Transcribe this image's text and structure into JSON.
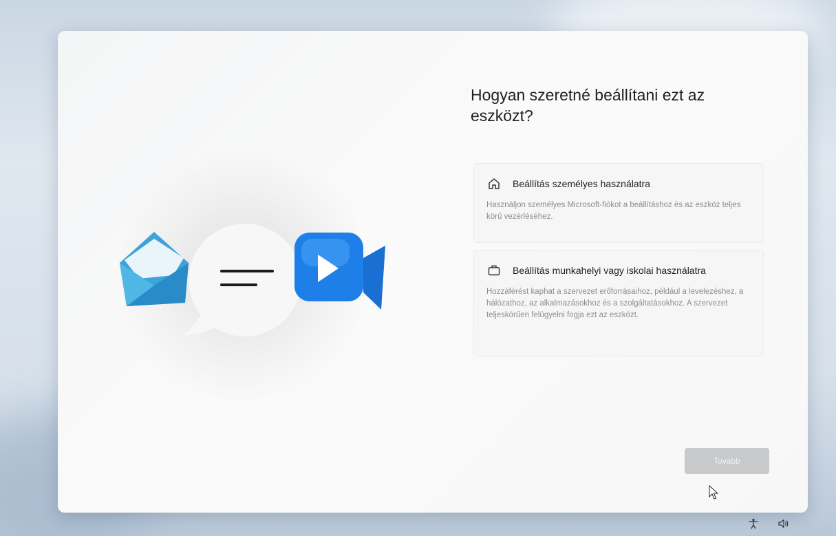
{
  "setup": {
    "title": "Hogyan szeretné beállítani ezt az eszközt?",
    "options": [
      {
        "title": "Beállítás személyes használatra",
        "description": "Használjon személyes Microsoft-fiókot a beállításhoz és az eszköz teljes körű vezérléséhez.",
        "icon": "home-icon"
      },
      {
        "title": "Beállítás munkahelyi vagy iskolai használatra",
        "description": "Hozzáférést kaphat a szervezet erőforrásaihoz, például a levelezéshez, a hálózathoz, az alkalmazásokhoz és a szolgáltatásokhoz. A szervezet teljeskörűen felügyelni fogja ezt az eszközt.",
        "icon": "briefcase-icon"
      }
    ],
    "next_label": "Tovább"
  },
  "taskbar": {
    "icons": [
      "accessibility-icon",
      "volume-icon"
    ]
  },
  "colors": {
    "mail_blue": "#2f8fd6",
    "video_blue": "#1e7fe8",
    "button_disabled": "#c8c9cb"
  }
}
